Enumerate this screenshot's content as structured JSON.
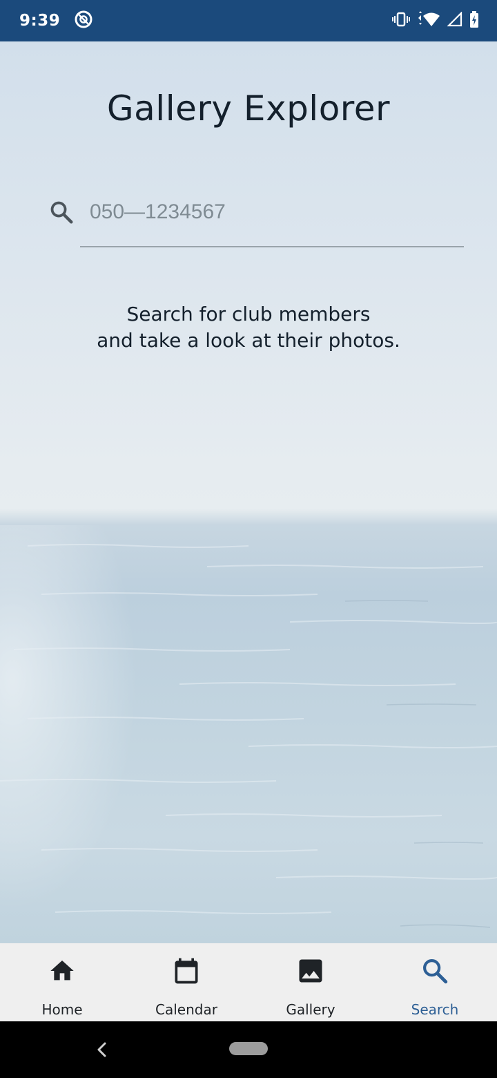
{
  "status_bar": {
    "time": "9:39"
  },
  "title": "Gallery Explorer",
  "search": {
    "placeholder": "050—1234567"
  },
  "info": {
    "line1": "Search for club members",
    "line2": "and take a look at their photos."
  },
  "bottom_nav": {
    "items": [
      {
        "label": "Home",
        "icon": "home-icon"
      },
      {
        "label": "Calendar",
        "icon": "calendar-icon"
      },
      {
        "label": "Gallery",
        "icon": "image-icon"
      },
      {
        "label": "Search",
        "icon": "search-icon"
      }
    ],
    "active": "Search"
  },
  "colors": {
    "status_bar": "#1b4a7c",
    "accent": "#2d5f95",
    "text": "#14202c",
    "nav_bg": "#efefef"
  }
}
